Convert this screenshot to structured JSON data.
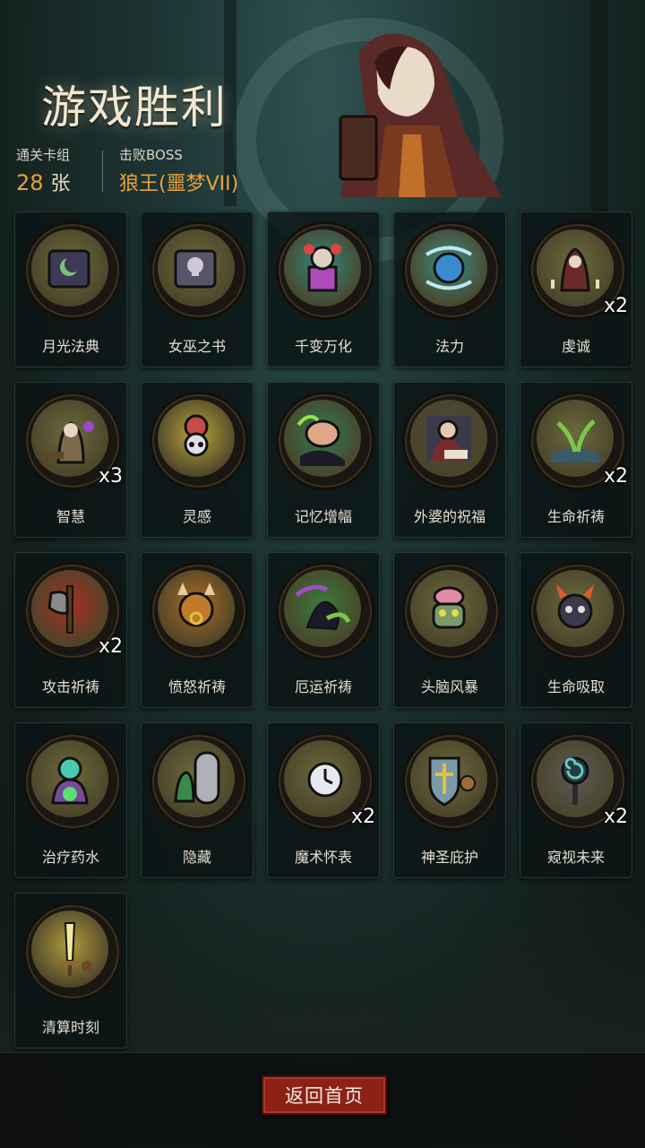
{
  "header": {
    "title": "游戏胜利",
    "stats": {
      "cards_label": "通关卡组",
      "cards_value": "28",
      "cards_unit": "张",
      "boss_label": "击败BOSS",
      "boss_value": "狼王(噩梦VII)"
    }
  },
  "cards": [
    {
      "label": "月光法典",
      "icon": "book-moon-icon",
      "color": "#6b6a3c",
      "count": ""
    },
    {
      "label": "女巫之书",
      "icon": "book-skull-icon",
      "color": "#6b6a3c",
      "count": ""
    },
    {
      "label": "千变万化",
      "icon": "jester-box-icon",
      "color": "#2f8a80",
      "count": ""
    },
    {
      "label": "法力",
      "icon": "mana-orb-icon",
      "color": "#3a8f86",
      "count": ""
    },
    {
      "label": "虔诚",
      "icon": "praying-monk-icon",
      "color": "#6b6a3c",
      "count": "x2"
    },
    {
      "label": "智慧",
      "icon": "sage-icon",
      "color": "#6b6a3c",
      "count": "x3"
    },
    {
      "label": "灵感",
      "icon": "brain-skull-icon",
      "color": "#b8a23a",
      "count": ""
    },
    {
      "label": "记忆增幅",
      "icon": "brain-icon",
      "color": "#2f7a50",
      "count": ""
    },
    {
      "label": "外婆的祝福",
      "icon": "grandma-icon",
      "color": "#4a4a3a",
      "count": ""
    },
    {
      "label": "生命祈祷",
      "icon": "sprout-icon",
      "color": "#6b6a3c",
      "count": "x2"
    },
    {
      "label": "攻击祈祷",
      "icon": "axe-icon",
      "color": "#a63020",
      "count": "x2"
    },
    {
      "label": "愤怒祈祷",
      "icon": "rage-beast-icon",
      "color": "#b06a20",
      "count": ""
    },
    {
      "label": "厄运祈祷",
      "icon": "doom-bird-icon",
      "color": "#3a7a3a",
      "count": ""
    },
    {
      "label": "头脑风暴",
      "icon": "zombie-brain-icon",
      "color": "#6b6a3c",
      "count": ""
    },
    {
      "label": "生命吸取",
      "icon": "demon-icon",
      "color": "#6b6a3c",
      "count": ""
    },
    {
      "label": "治疗药水",
      "icon": "potion-ghoul-icon",
      "color": "#6b6a3c",
      "count": ""
    },
    {
      "label": "隐藏",
      "icon": "goblin-door-icon",
      "color": "#6b6a3c",
      "count": ""
    },
    {
      "label": "魔术怀表",
      "icon": "pocket-watch-icon",
      "color": "#6b6a3c",
      "count": "x2"
    },
    {
      "label": "神圣庇护",
      "icon": "holy-shield-icon",
      "color": "#6b6a3c",
      "count": ""
    },
    {
      "label": "窥视未来",
      "icon": "spiral-staff-icon",
      "color": "#5a5a58",
      "count": "x2"
    },
    {
      "label": "清算时刻",
      "icon": "light-sword-icon",
      "color": "#b09a3a",
      "count": ""
    }
  ],
  "footer": {
    "home_label": "返回首页"
  }
}
